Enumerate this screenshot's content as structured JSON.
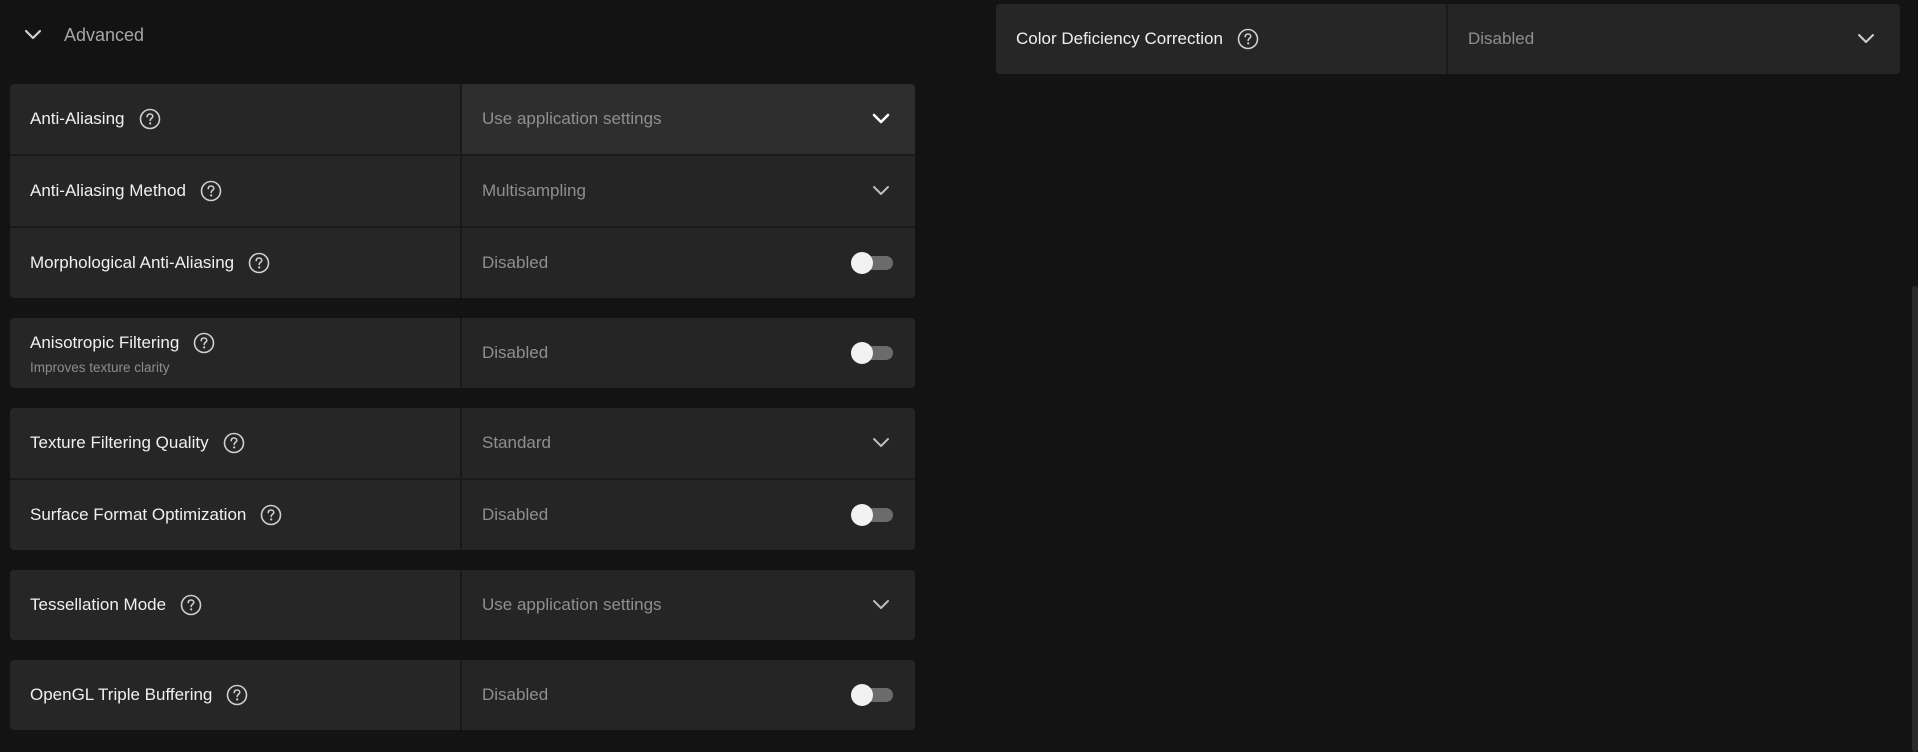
{
  "advanced": {
    "label": "Advanced",
    "icon": "chevron-down-icon"
  },
  "right_setting": {
    "label": "Color Deficiency Correction",
    "value": "Disabled",
    "control": "dropdown"
  },
  "groups": [
    [
      {
        "label": "Anti-Aliasing",
        "value": "Use application settings",
        "control": "dropdown",
        "highlighted": true
      },
      {
        "label": "Anti-Aliasing Method",
        "value": "Multisampling",
        "control": "dropdown"
      },
      {
        "label": "Morphological Anti-Aliasing",
        "value": "Disabled",
        "control": "toggle",
        "on": false
      }
    ],
    [
      {
        "label": "Anisotropic Filtering",
        "sublabel": "Improves texture clarity",
        "value": "Disabled",
        "control": "toggle",
        "on": false
      }
    ],
    [
      {
        "label": "Texture Filtering Quality",
        "value": "Standard",
        "control": "dropdown"
      },
      {
        "label": "Surface Format Optimization",
        "value": "Disabled",
        "control": "toggle",
        "on": false
      }
    ],
    [
      {
        "label": "Tessellation Mode",
        "value": "Use application settings",
        "control": "dropdown"
      }
    ],
    [
      {
        "label": "OpenGL Triple Buffering",
        "value": "Disabled",
        "control": "toggle",
        "on": false
      }
    ]
  ],
  "colors": {
    "background": "#131313",
    "panel": "#242424",
    "text": "#f0f0f0",
    "muted": "#8f8f8f",
    "toggle_off": "#6b6b6b"
  }
}
